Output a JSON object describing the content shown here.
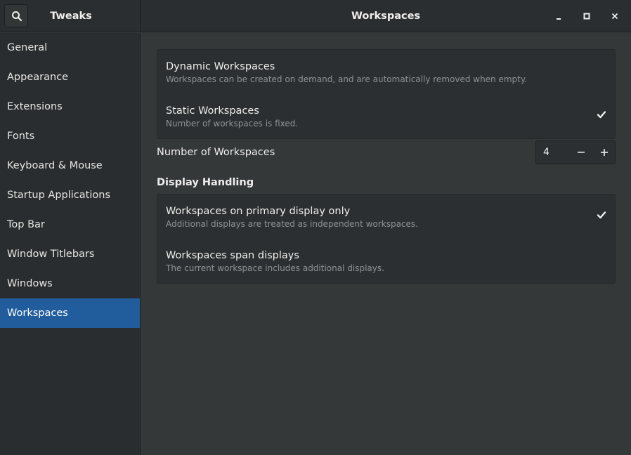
{
  "header": {
    "app_title": "Tweaks",
    "page_title": "Workspaces",
    "icons": {
      "search": "search-icon",
      "minimize": "minimize-icon",
      "maximize": "maximize-icon",
      "close": "close-icon"
    }
  },
  "sidebar": {
    "items": [
      {
        "label": "General"
      },
      {
        "label": "Appearance"
      },
      {
        "label": "Extensions"
      },
      {
        "label": "Fonts"
      },
      {
        "label": "Keyboard & Mouse"
      },
      {
        "label": "Startup Applications"
      },
      {
        "label": "Top Bar"
      },
      {
        "label": "Window Titlebars"
      },
      {
        "label": "Windows"
      },
      {
        "label": "Workspaces",
        "active": true
      }
    ]
  },
  "workspaces_mode": {
    "options": [
      {
        "title": "Dynamic Workspaces",
        "subtitle": "Workspaces can be created on demand, and are automatically removed when empty.",
        "selected": false
      },
      {
        "title": "Static Workspaces",
        "subtitle": "Number of workspaces is fixed.",
        "selected": true
      }
    ]
  },
  "number_of_workspaces": {
    "label": "Number of Workspaces",
    "value": "4"
  },
  "display_handling": {
    "heading": "Display Handling",
    "options": [
      {
        "title": "Workspaces on primary display only",
        "subtitle": "Additional displays are treated as independent workspaces.",
        "selected": true
      },
      {
        "title": "Workspaces span displays",
        "subtitle": "The current workspace includes additional displays.",
        "selected": false
      }
    ]
  },
  "colors": {
    "accent": "#215d9c",
    "window_bg": "#353839",
    "sidebar_bg": "#2a2d2f",
    "card_bg": "#2c2f31"
  }
}
